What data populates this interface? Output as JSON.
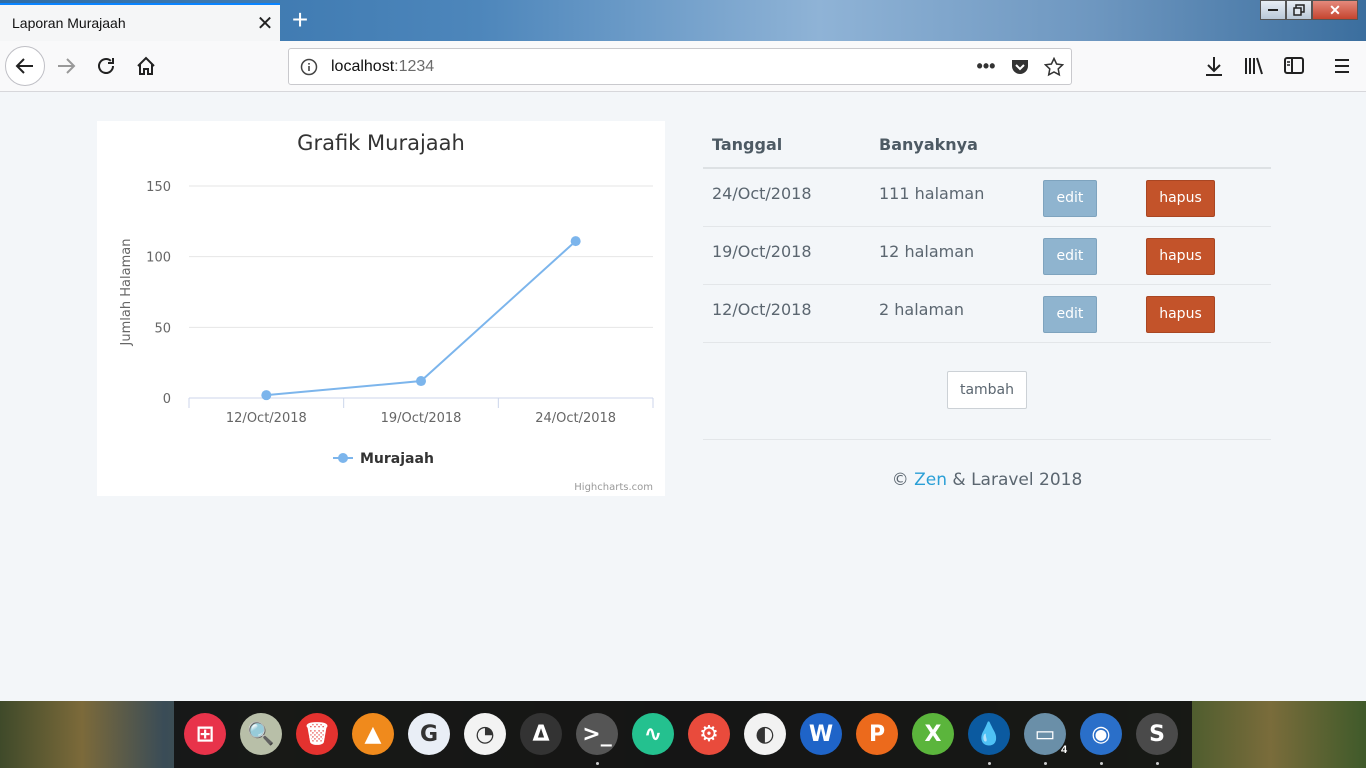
{
  "browser": {
    "tab_title": "Laporan Murajaah",
    "url_host": "localhost",
    "url_port": ":1234"
  },
  "chart_data": {
    "type": "line",
    "title": "Grafik Murajaah",
    "xlabel": "",
    "ylabel": "Jumlah Halaman",
    "categories": [
      "12/Oct/2018",
      "19/Oct/2018",
      "24/Oct/2018"
    ],
    "series": [
      {
        "name": "Murajaah",
        "values": [
          2,
          12,
          111
        ],
        "color": "#7cb5ec"
      }
    ],
    "ylim": [
      0,
      150
    ],
    "yticks": [
      0,
      50,
      100,
      150
    ],
    "grid": true,
    "legend": "bottom-center",
    "credits": "Highcharts.com"
  },
  "table": {
    "headers": [
      "Tanggal",
      "Banyaknya"
    ],
    "rows": [
      {
        "tanggal": "24/Oct/2018",
        "banyaknya": "111 halaman"
      },
      {
        "tanggal": "19/Oct/2018",
        "banyaknya": "12 halaman"
      },
      {
        "tanggal": "12/Oct/2018",
        "banyaknya": "2 halaman"
      }
    ],
    "edit_label": "edit",
    "hapus_label": "hapus",
    "tambah_label": "tambah"
  },
  "footer": {
    "copyright": "©",
    "link_text": "Zen",
    "suffix": "& Laravel 2018"
  },
  "taskbar": {
    "folder_badge": "4",
    "apps": [
      {
        "name": "windows",
        "color": "#e8334a",
        "glyph": "⊞"
      },
      {
        "name": "search",
        "color": "#b8bfa8",
        "glyph": "🔍"
      },
      {
        "name": "trash",
        "color": "#e4322f",
        "glyph": "🗑"
      },
      {
        "name": "vlc",
        "color": "#f08a1c",
        "glyph": "▲"
      },
      {
        "name": "firefox-dev",
        "color": "#e9eef6",
        "glyph": "G"
      },
      {
        "name": "disk-usage",
        "color": "#f3f3f3",
        "glyph": "◔"
      },
      {
        "name": "inkscape",
        "color": "#333333",
        "glyph": "Δ"
      },
      {
        "name": "terminal",
        "color": "#555555",
        "glyph": ">_"
      },
      {
        "name": "system-monitor",
        "color": "#24c18f",
        "glyph": "∿"
      },
      {
        "name": "settings",
        "color": "#e94b3c",
        "glyph": "⚙"
      },
      {
        "name": "eclipse",
        "color": "#f2f2f2",
        "glyph": "◐"
      },
      {
        "name": "word",
        "color": "#1f64c8",
        "glyph": "W"
      },
      {
        "name": "presentation",
        "color": "#ec6a1c",
        "glyph": "P"
      },
      {
        "name": "spreadsheet",
        "color": "#5bb53c",
        "glyph": "X"
      },
      {
        "name": "drop",
        "color": "#0b5aa0",
        "glyph": "💧"
      },
      {
        "name": "files",
        "color": "#6a8fa8",
        "glyph": "▭"
      },
      {
        "name": "firefox",
        "color": "#2a6fc9",
        "glyph": "◉"
      },
      {
        "name": "sublime",
        "color": "#4a4a4a",
        "glyph": "S"
      }
    ]
  }
}
